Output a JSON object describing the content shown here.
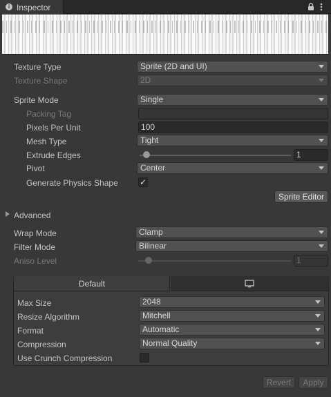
{
  "window": {
    "tab_title": "Inspector",
    "info_icon": "info-icon",
    "lock_icon": "lock-icon",
    "more_icon": "kebab-menu-icon"
  },
  "texture": {
    "texture_type": {
      "label": "Texture Type",
      "value": "Sprite (2D and UI)"
    },
    "texture_shape": {
      "label": "Texture Shape",
      "value": "2D"
    },
    "sprite_mode": {
      "label": "Sprite Mode",
      "value": "Single"
    },
    "packing_tag": {
      "label": "Packing Tag",
      "value": ""
    },
    "pixels_per_unit": {
      "label": "Pixels Per Unit",
      "value": "100"
    },
    "mesh_type": {
      "label": "Mesh Type",
      "value": "Tight"
    },
    "extrude_edges": {
      "label": "Extrude Edges",
      "value": "1"
    },
    "pivot": {
      "label": "Pivot",
      "value": "Center"
    },
    "generate_physics": {
      "label": "Generate Physics Shape",
      "checked": true,
      "mark": "✓"
    },
    "sprite_editor_button": "Sprite Editor",
    "advanced_label": "Advanced",
    "wrap_mode": {
      "label": "Wrap Mode",
      "value": "Clamp"
    },
    "filter_mode": {
      "label": "Filter Mode",
      "value": "Bilinear"
    },
    "aniso_level": {
      "label": "Aniso Level",
      "value": "1"
    }
  },
  "platform": {
    "tabs": [
      {
        "label": "Default"
      },
      {
        "icon": "monitor-icon"
      }
    ],
    "max_size": {
      "label": "Max Size",
      "value": "2048"
    },
    "resize_algorithm": {
      "label": "Resize Algorithm",
      "value": "Mitchell"
    },
    "format": {
      "label": "Format",
      "value": "Automatic"
    },
    "compression": {
      "label": "Compression",
      "value": "Normal Quality"
    },
    "crunch": {
      "label": "Use Crunch Compression",
      "checked": false
    }
  },
  "footer": {
    "revert": "Revert",
    "apply": "Apply"
  },
  "colors": {
    "background": "#383838",
    "field": "#2a2a2a",
    "dropdown": "#515151",
    "text": "#c4c4c4"
  }
}
